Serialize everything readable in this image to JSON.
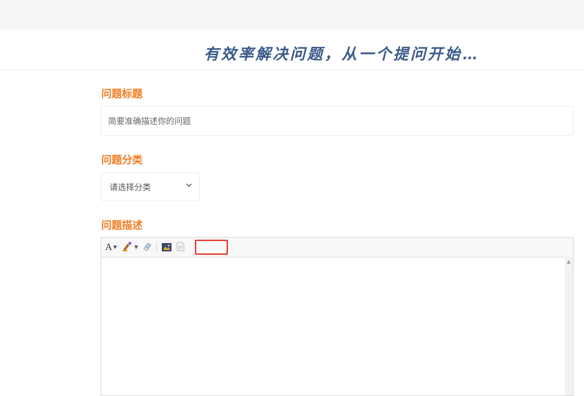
{
  "header": {
    "slogan": "有效率解决问题，从一个提问开始…"
  },
  "form": {
    "title_label": "问题标题",
    "title_placeholder": "简要准确描述你的问题",
    "category_label": "问题分类",
    "category_selected": "请选择分类",
    "description_label": "问题描述"
  },
  "editor": {
    "toolbar": [
      {
        "name": "font-style",
        "icon": "font-icon",
        "glyph": "A"
      },
      {
        "name": "font-color",
        "icon": "paint-brush-icon"
      },
      {
        "name": "clear-format",
        "icon": "eraser-icon"
      },
      {
        "name": "insert-image",
        "icon": "image-icon"
      },
      {
        "name": "insert-file",
        "icon": "file-icon"
      }
    ]
  },
  "colors": {
    "accent": "#f07c22",
    "slogan": "#3b5a8a",
    "highlight": "#e53a35"
  }
}
